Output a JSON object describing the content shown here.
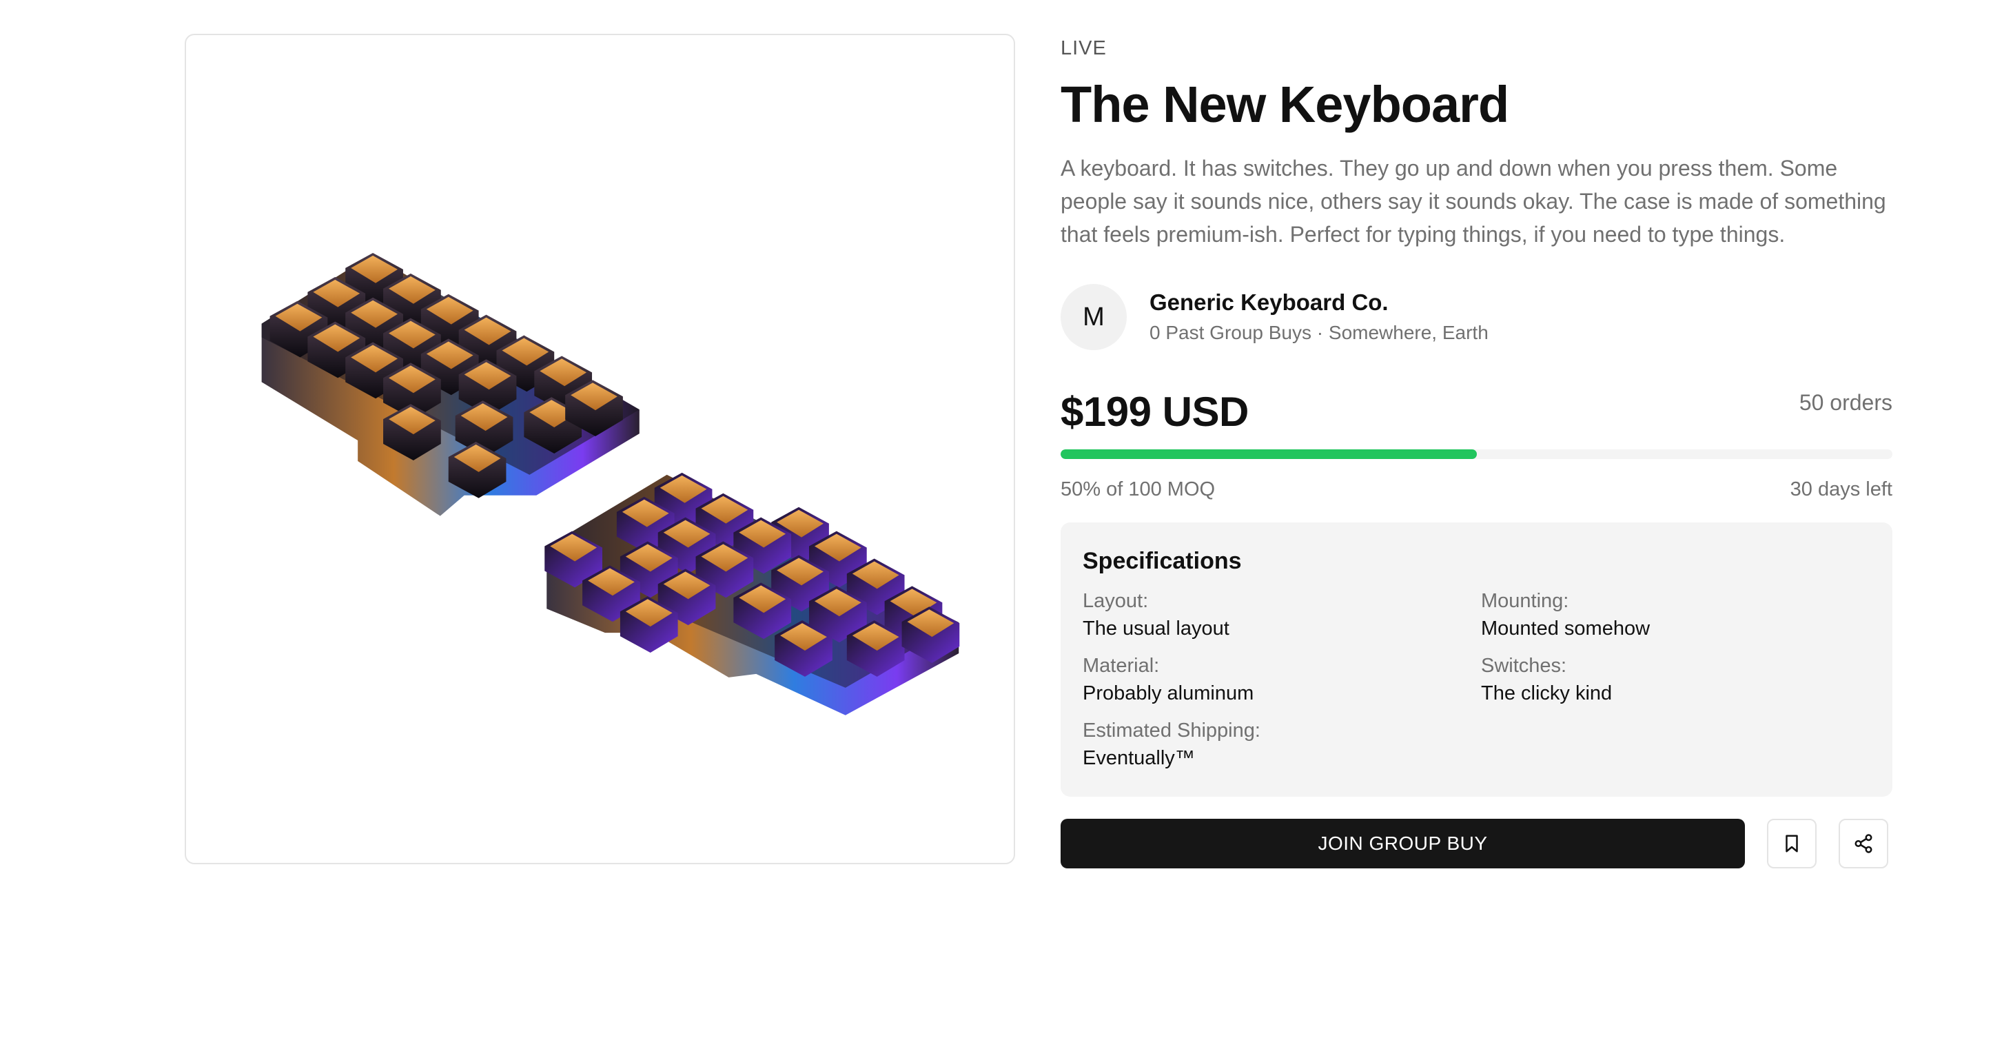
{
  "product": {
    "status": "LIVE",
    "title": "The New Keyboard",
    "description": "A keyboard. It has switches. They go up and down when you press them. Some people say it sounds nice, others say it sounds okay. The case is made of something that feels premium-ish. Perfect for typing things, if you need to type things.",
    "image_alt": "Split keyboard with iridescent case and orange keycaps"
  },
  "seller": {
    "avatar_initial": "M",
    "name": "Generic Keyboard Co.",
    "meta": "0 Past Group Buys · Somewhere, Earth"
  },
  "pricing": {
    "price": "$199 USD",
    "orders": "50 orders",
    "progress_fraction": 0.5,
    "progress_label": "50% of 100 MOQ",
    "time_left": "30 days left"
  },
  "specs": {
    "title": "Specifications",
    "layout_label": "Layout:",
    "layout_value": "The usual layout",
    "mounting_label": "Mounting:",
    "mounting_value": "Mounted somehow",
    "material_label": "Material:",
    "material_value": "Probably aluminum",
    "switches_label": "Switches:",
    "switches_value": "The clicky kind",
    "shipping_label": "Estimated Shipping:",
    "shipping_value": "Eventually™"
  },
  "actions": {
    "join_label": "JOIN GROUP BUY",
    "bookmark_icon": "bookmark-icon",
    "share_icon": "share-icon"
  },
  "colors": {
    "accent_green": "#22c55e",
    "button_dark": "#161616",
    "keycap_orange": "#e89a3c",
    "case_purple": "#7a3cf0"
  }
}
